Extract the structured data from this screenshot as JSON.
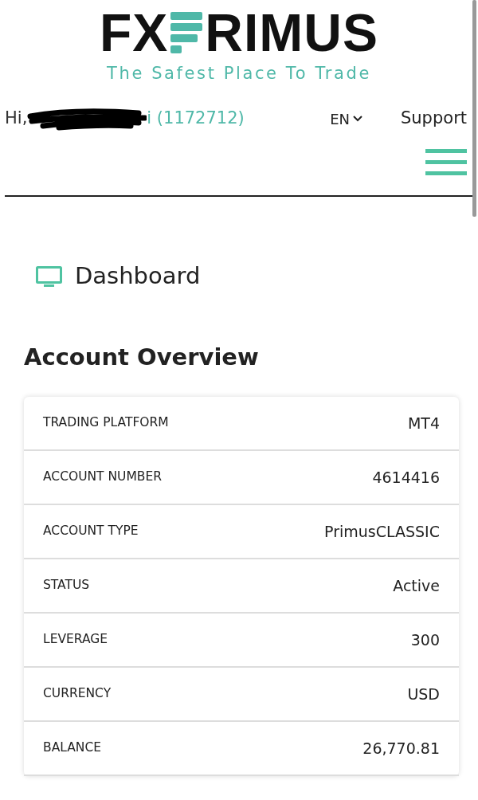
{
  "logo": {
    "left": "FX",
    "right": "RIMUS",
    "tagline": "The Safest Place To Trade"
  },
  "header": {
    "greeting": "Hi,",
    "account": "i (1172712)",
    "language": "EN",
    "support": "Support"
  },
  "page": {
    "title": "Dashboard"
  },
  "overview": {
    "title": "Account Overview",
    "rows": [
      {
        "label": "TRADING PLATFORM",
        "value": "MT4"
      },
      {
        "label": "ACCOUNT NUMBER",
        "value": "4614416"
      },
      {
        "label": "ACCOUNT TYPE",
        "value": "PrimusCLASSIC"
      },
      {
        "label": "STATUS",
        "value": "Active"
      },
      {
        "label": "LEVERAGE",
        "value": "300"
      },
      {
        "label": "CURRENCY",
        "value": "USD"
      },
      {
        "label": "BALANCE",
        "value": "26,770.81"
      }
    ]
  }
}
